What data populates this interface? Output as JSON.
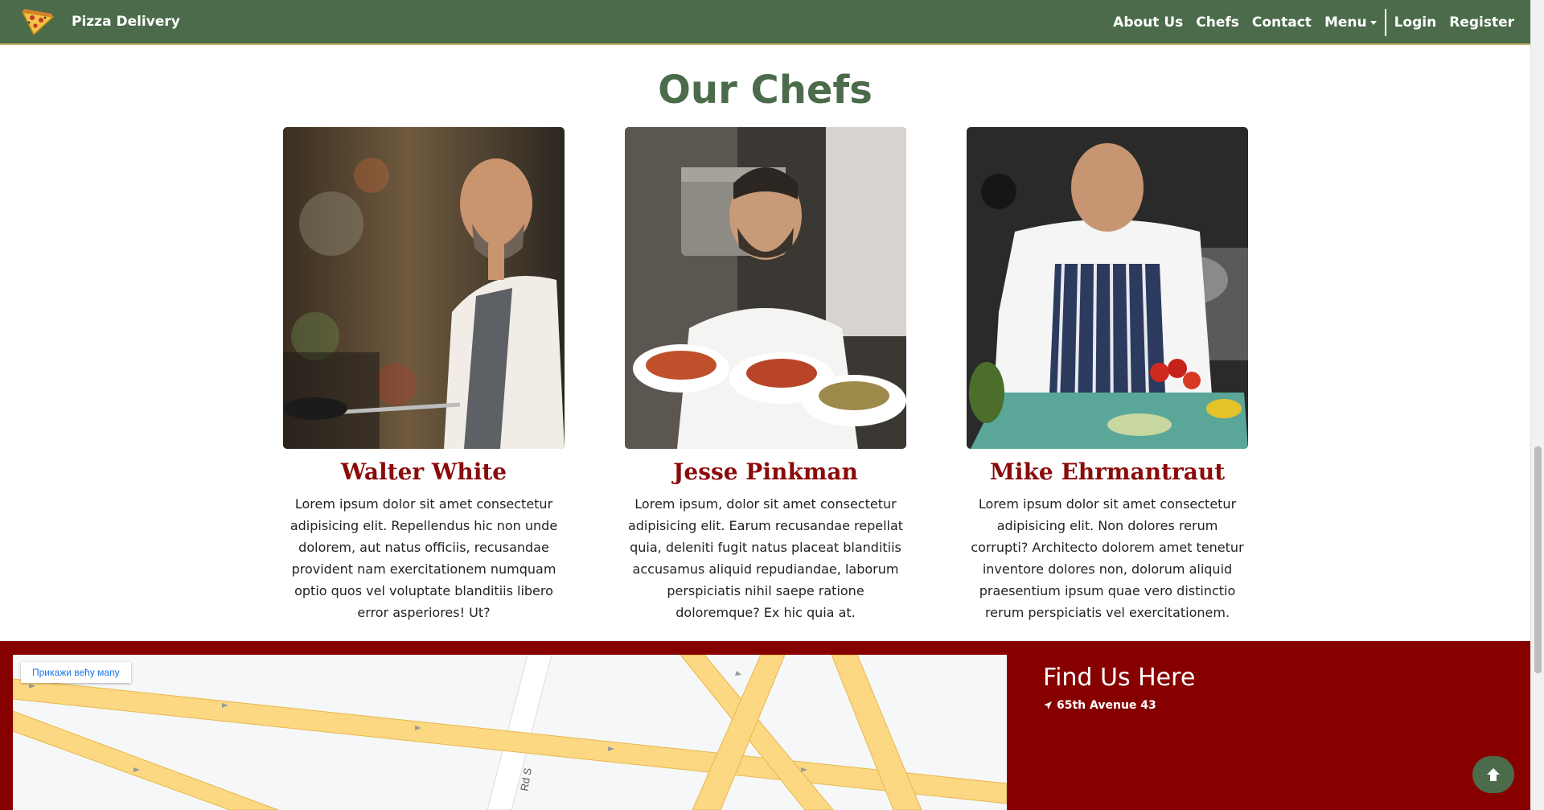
{
  "navbar": {
    "brand": "Pizza Delivery",
    "links": [
      "About Us",
      "Chefs",
      "Contact"
    ],
    "menu_label": "Menu",
    "login_label": "Login",
    "register_label": "Register"
  },
  "section": {
    "title": "Our Chefs"
  },
  "chefs": [
    {
      "name": "Walter White",
      "description": "Lorem ipsum dolor sit amet consectetur adipisicing elit. Repellendus hic non unde dolorem, aut natus officiis, recusandae provident nam exercitationem numquam optio quos vel voluptate blanditiis libero error asperiores! Ut?"
    },
    {
      "name": "Jesse Pinkman",
      "description": "Lorem ipsum, dolor sit amet consectetur adipisicing elit. Earum recusandae repellat quia, deleniti fugit natus placeat blanditiis accusamus aliquid repudiandae, laborum perspiciatis nihil saepe ratione doloremque? Ex hic quia at."
    },
    {
      "name": "Mike Ehrmantraut",
      "description": "Lorem ipsum dolor sit amet consectetur adipisicing elit. Non dolores rerum corrupti? Architecto dolorem amet tenetur inventore dolores non, dolorum aliquid praesentium ipsum quae vero distinctio rerum perspiciatis vel exercitationem."
    }
  ],
  "footer": {
    "map_button": "Прикажи већу мапу",
    "map_street": "Rd S",
    "find_title": "Find Us Here",
    "address": "65th Avenue 43"
  },
  "colors": {
    "navbar": "#4b6b4b",
    "chef_name": "#8b0a0a",
    "footer": "#870000"
  }
}
